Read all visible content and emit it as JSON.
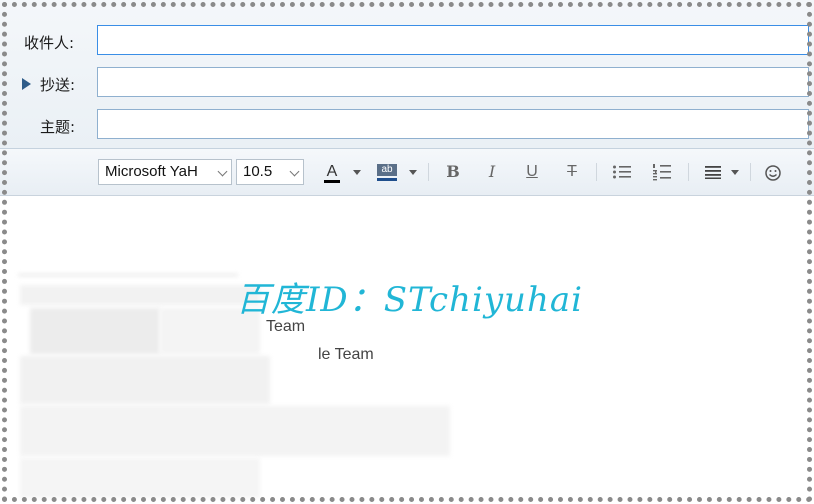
{
  "fields": {
    "to_label": "收件人:",
    "cc_label": "抄送:",
    "subject_label": "主题:",
    "to_value": "",
    "cc_value": "",
    "subject_value": ""
  },
  "toolbar": {
    "font_family": "Microsoft YaH",
    "font_size": "10.5",
    "font_color_glyph": "A",
    "highlight_glyph": "ab",
    "bold_glyph": "B",
    "italic_glyph": "I",
    "underline_glyph": "U",
    "strike_glyph": "T"
  },
  "body": {
    "line1": "Team",
    "line2": "le Team"
  },
  "watermark": "百度ID：STchiyuhai",
  "colors": {
    "accent": "#3a8ee6",
    "watermark": "#21b6d6",
    "font_color_bar": "#000000",
    "highlight_bar": "#1f4e8c"
  },
  "icons": [
    "expand-arrow-icon",
    "font-color-icon",
    "highlight-icon",
    "bold-icon",
    "italic-icon",
    "underline-icon",
    "strikethrough-icon",
    "bullet-list-icon",
    "numbered-list-icon",
    "align-icon",
    "emoji-icon"
  ]
}
